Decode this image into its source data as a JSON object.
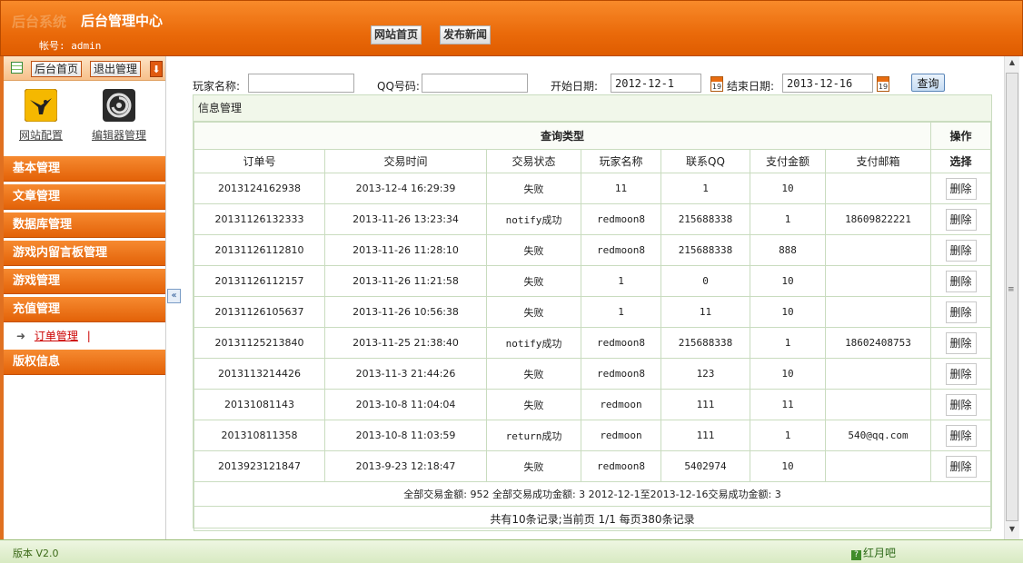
{
  "header": {
    "logo_ghost": "后台系统",
    "title": "后台管理中心",
    "account_label": "帐号:",
    "account_value": "admin",
    "nav": [
      "网站首页",
      "发布新闻"
    ]
  },
  "sidebar": {
    "toolbar": {
      "home": "后台首页",
      "logout": "退出管理"
    },
    "quick": [
      {
        "label": "网站配置",
        "icon": "bird-icon"
      },
      {
        "label": "编辑器管理",
        "icon": "spiral-icon"
      }
    ],
    "menu": [
      "基本管理",
      "文章管理",
      "数据库管理",
      "游戏内留言板管理",
      "游戏管理",
      "充值管理",
      "版权信息"
    ],
    "submenu": {
      "label": "订单管理",
      "bar": "|"
    }
  },
  "search": {
    "player_label": "玩家名称:",
    "player_value": "",
    "qq_label": "QQ号码:",
    "qq_value": "",
    "start_label": "开始日期:",
    "start_value": "2012-12-1",
    "end_label": "结束日期:",
    "end_value": "2013-12-16",
    "query_button": "查询"
  },
  "panel": {
    "title": "信息管理",
    "group_header": "查询类型",
    "ops_header": "操作",
    "columns": [
      "订单号",
      "交易时间",
      "交易状态",
      "玩家名称",
      "联系QQ",
      "支付金额",
      "支付邮箱",
      "选择"
    ],
    "delete_label": "删除",
    "rows": [
      [
        "2013124162938",
        "2013-12-4 16:29:39",
        "失败",
        "11",
        "1",
        "10",
        ""
      ],
      [
        "20131126132333",
        "2013-11-26 13:23:34",
        "notify成功",
        "redmoon8",
        "215688338",
        "1",
        "18609822221"
      ],
      [
        "20131126112810",
        "2013-11-26 11:28:10",
        "失败",
        "redmoon8",
        "215688338",
        "888",
        ""
      ],
      [
        "20131126112157",
        "2013-11-26 11:21:58",
        "失败",
        "1",
        "0",
        "10",
        ""
      ],
      [
        "20131126105637",
        "2013-11-26 10:56:38",
        "失败",
        "1",
        "11",
        "10",
        ""
      ],
      [
        "20131125213840",
        "2013-11-25 21:38:40",
        "notify成功",
        "redmoon8",
        "215688338",
        "1",
        "18602408753"
      ],
      [
        "2013113214426",
        "2013-11-3 21:44:26",
        "失败",
        "redmoon8",
        "123",
        "10",
        ""
      ],
      [
        "20131081143",
        "2013-10-8 11:04:04",
        "失败",
        "redmoon",
        "111",
        "11",
        ""
      ],
      [
        "201310811358",
        "2013-10-8 11:03:59",
        "return成功",
        "redmoon",
        "111",
        "1",
        "540@qq.com"
      ],
      [
        "2013923121847",
        "2013-9-23 12:18:47",
        "失败",
        "redmoon8",
        "5402974",
        "10",
        ""
      ]
    ],
    "summary": "全部交易金额: 952 全部交易成功金额: 3   2012-12-1至2013-12-16交易成功金额: 3",
    "pagination": "共有10条记录;当前页 1/1    每页380条记录"
  },
  "footer": {
    "version": "版本 V2.0",
    "brand": "红月吧"
  },
  "colors": {
    "accent": "#ea6a0a",
    "panel_border": "#c9dcbf",
    "footer_green": "#d8eac2"
  }
}
